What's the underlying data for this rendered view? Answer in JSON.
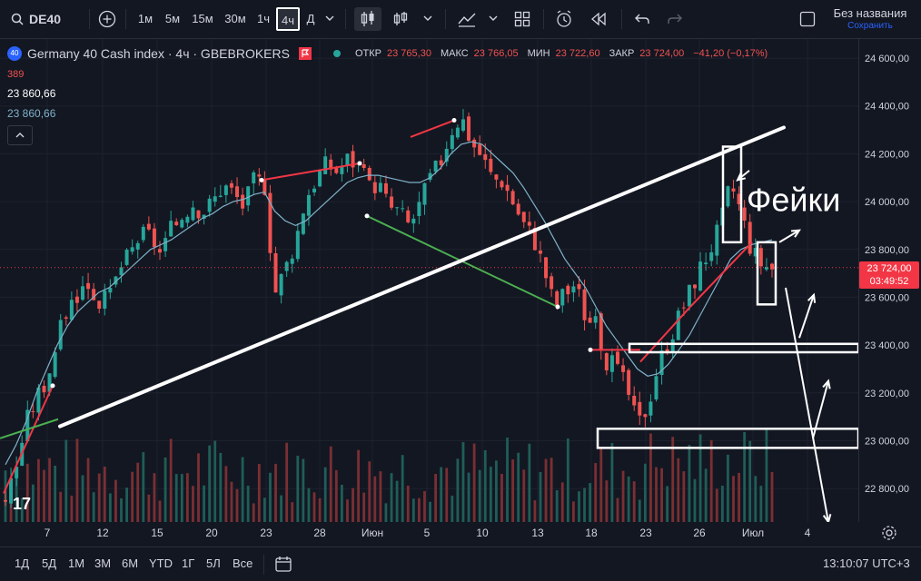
{
  "toolbar": {
    "symbol": "DE40",
    "timeframes": [
      "1м",
      "5м",
      "15м",
      "30м",
      "1ч",
      "4ч",
      "Д"
    ],
    "active_timeframe": "4ч",
    "layout_name": "Без названия",
    "saved_status": "Сохранить"
  },
  "legend": {
    "badge": "40",
    "title": "Germany 40 Cash index · 4ч · GBEBROKERS",
    "open_label": "ОТКР",
    "open": "23 765,30",
    "high_label": "МАКС",
    "high": "23 766,05",
    "low_label": "МИН",
    "low": "23 722,60",
    "close_label": "ЗАКР",
    "close": "23 724,00",
    "change": "−41,20 (−0,17%)",
    "volume": "389",
    "ma1": "23 860,66",
    "ma2": "23 860,66"
  },
  "annotation": {
    "text": "Фейки"
  },
  "current_price": {
    "price": "23 724,00",
    "countdown": "03:49:52"
  },
  "bottom": {
    "ranges": [
      "1Д",
      "5Д",
      "1М",
      "3М",
      "6М",
      "YTD",
      "1Г",
      "5Л",
      "Все"
    ],
    "clock": "13:10:07 UTC+3"
  },
  "colors": {
    "up": "#26a69a",
    "down": "#ef5350",
    "background": "#131722",
    "ma": "#7fb2c9",
    "drawing": "#ffffff",
    "trend_red": "#f23645",
    "trend_green": "#4caf50"
  },
  "chart_data": {
    "type": "candlestick",
    "title": "Germany 40 Cash index · 4ч · GBEBROKERS",
    "xlabel": "",
    "ylabel": "",
    "x_ticks": [
      "7",
      "12",
      "15",
      "20",
      "23",
      "28",
      "Июн",
      "5",
      "10",
      "13",
      "18",
      "23",
      "26",
      "Июл",
      "4"
    ],
    "y_ticks": [
      22800,
      23000,
      23200,
      23400,
      23600,
      23800,
      24000,
      24200,
      24400,
      24600
    ],
    "y_tick_labels": [
      "22 800,00",
      "23 000,00",
      "23 200,00",
      "23 400,00",
      "23 600,00",
      "23 800,00",
      "24 000,00",
      "24 200,00",
      "24 400,00",
      "24 600,00"
    ],
    "ylim": [
      22660,
      24680
    ],
    "price_path": [
      22760,
      22890,
      23080,
      23180,
      23260,
      23420,
      23560,
      23620,
      23660,
      23580,
      23590,
      23720,
      23780,
      23860,
      23860,
      23780,
      23880,
      23940,
      24000,
      23960,
      24000,
      24070,
      24040,
      23980,
      24090,
      24080,
      23620,
      23720,
      23840,
      24020,
      24100,
      24160,
      24130,
      24180,
      24160,
      24060,
      24080,
      23980,
      23960,
      23900,
      23990,
      24100,
      24170,
      24300,
      24360,
      24250,
      24190,
      24100,
      24090,
      24000,
      23910,
      23850,
      23720,
      23560,
      23620,
      23660,
      23520,
      23480,
      23340,
      23300,
      23220,
      23060,
      23150,
      23320,
      23420,
      23520,
      23620,
      23720,
      23800,
      23900,
      24080,
      23960,
      23800,
      23740,
      23724
    ],
    "ma_path": [
      22900,
      22980,
      23080,
      23200,
      23300,
      23400,
      23480,
      23540,
      23580,
      23620,
      23640,
      23680,
      23720,
      23760,
      23800,
      23820,
      23840,
      23870,
      23900,
      23930,
      23950,
      23980,
      24000,
      24010,
      24030,
      24040,
      23960,
      23920,
      23900,
      23920,
      23960,
      24000,
      24040,
      24080,
      24100,
      24110,
      24110,
      24100,
      24090,
      24080,
      24080,
      24100,
      24140,
      24200,
      24240,
      24250,
      24240,
      24200,
      24160,
      24120,
      24060,
      23990,
      23920,
      23840,
      23760,
      23700,
      23640,
      23560,
      23480,
      23420,
      23360,
      23300,
      23270,
      23280,
      23320,
      23380,
      23440,
      23520,
      23600,
      23680,
      23760,
      23800,
      23820,
      23830,
      23840
    ],
    "volume_note": "volume histogram at bottom",
    "drawn_levels": [
      23390,
      23010
    ]
  }
}
